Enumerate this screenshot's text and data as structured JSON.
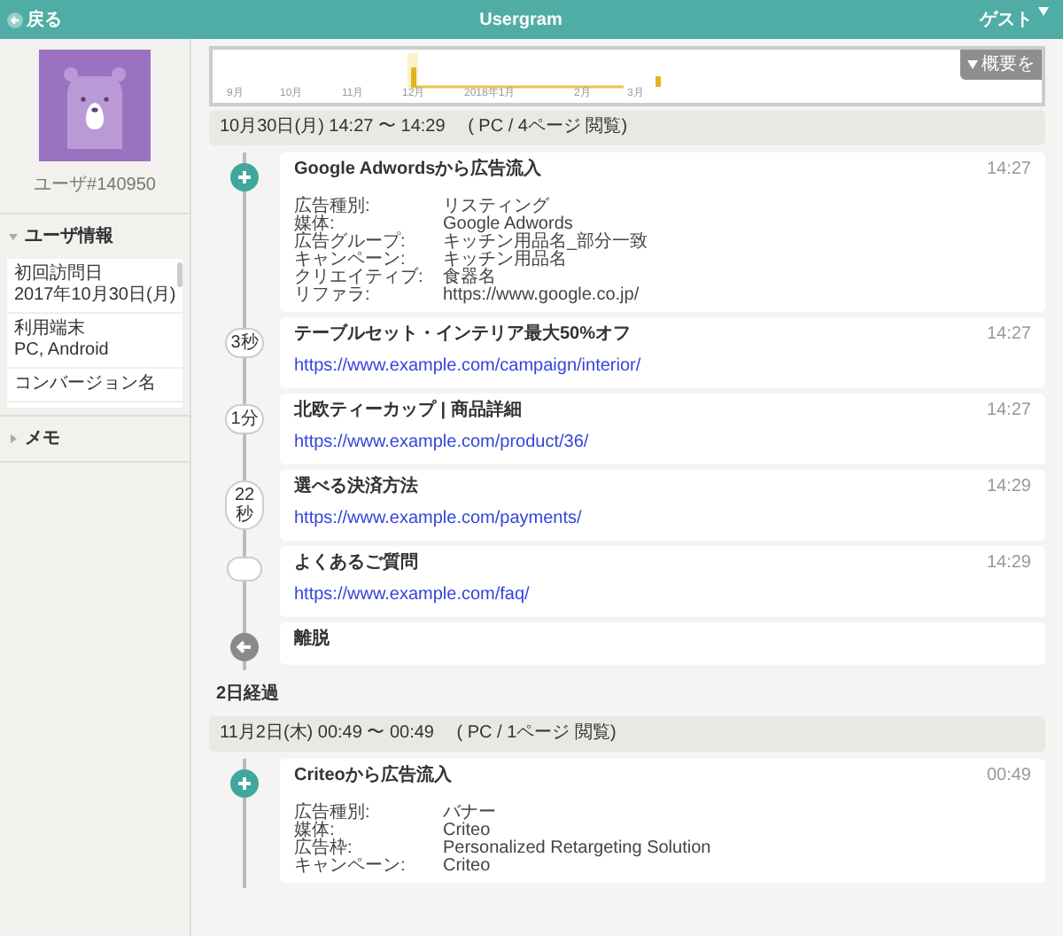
{
  "header": {
    "back": "戻る",
    "title": "Usergram",
    "user": "ゲスト"
  },
  "sidebar": {
    "user_id": "ユーザ#140950",
    "sections": [
      {
        "title": "ユーザ情報",
        "expanded": true,
        "items": [
          {
            "label": "初回訪問日",
            "value": "2017年10月30日(月)"
          },
          {
            "label": "利用端末",
            "value": "PC, Android"
          },
          {
            "label": "コンバージョン名"
          }
        ]
      },
      {
        "title": "メモ",
        "expanded": false
      }
    ]
  },
  "overview": {
    "labels": [
      "9月",
      "10月",
      "11月",
      "12月",
      "2018年1月",
      "2月",
      "3月"
    ],
    "toggle": "概要を"
  },
  "sessions": [
    {
      "header": "10月30日(月) 14:27 〜 14:29　 ( PC / 4ページ 閲覧)",
      "events": [
        {
          "kind": "inflow",
          "title": "Google Adwordsから広告流入",
          "time": "14:27",
          "details": [
            {
              "label": "広告種別:",
              "value": "リスティング"
            },
            {
              "label": "媒体:",
              "value": "Google Adwords"
            },
            {
              "label": "広告グループ:",
              "value": "キッチン用品名_部分一致"
            },
            {
              "label": "キャンペーン:",
              "value": "キッチン用品名"
            },
            {
              "label": "クリエイティブ:",
              "value": "食器名"
            },
            {
              "label": "リファラ:",
              "value": "https://www.google.co.jp/"
            }
          ]
        },
        {
          "kind": "page",
          "gap": "3秒",
          "title": "テーブルセット・インテリア最大50%オフ",
          "time": "14:27",
          "url": "https://www.example.com/campaign/interior/"
        },
        {
          "kind": "page",
          "gap": "1分",
          "title": "北欧ティーカップ | 商品詳細",
          "time": "14:27",
          "url": "https://www.example.com/product/36/"
        },
        {
          "kind": "page",
          "gap": "22秒",
          "title": "選べる決済方法",
          "time": "14:29",
          "url": "https://www.example.com/payments/"
        },
        {
          "kind": "page",
          "title": "よくあるご質問",
          "time": "14:29",
          "url": "https://www.example.com/faq/"
        },
        {
          "kind": "exit",
          "title": "離脱"
        }
      ],
      "after": "2日経過"
    },
    {
      "header": "11月2日(木) 00:49 〜 00:49　 ( PC / 1ページ 閲覧)",
      "events": [
        {
          "kind": "inflow",
          "title": "Criteoから広告流入",
          "time": "00:49",
          "details": [
            {
              "label": "広告種別:",
              "value": "バナー"
            },
            {
              "label": "媒体:",
              "value": "Criteo"
            },
            {
              "label": "広告枠:",
              "value": "Personalized Retargeting Solution"
            },
            {
              "label": "キャンペーン:",
              "value": "Criteo"
            }
          ]
        }
      ]
    }
  ]
}
